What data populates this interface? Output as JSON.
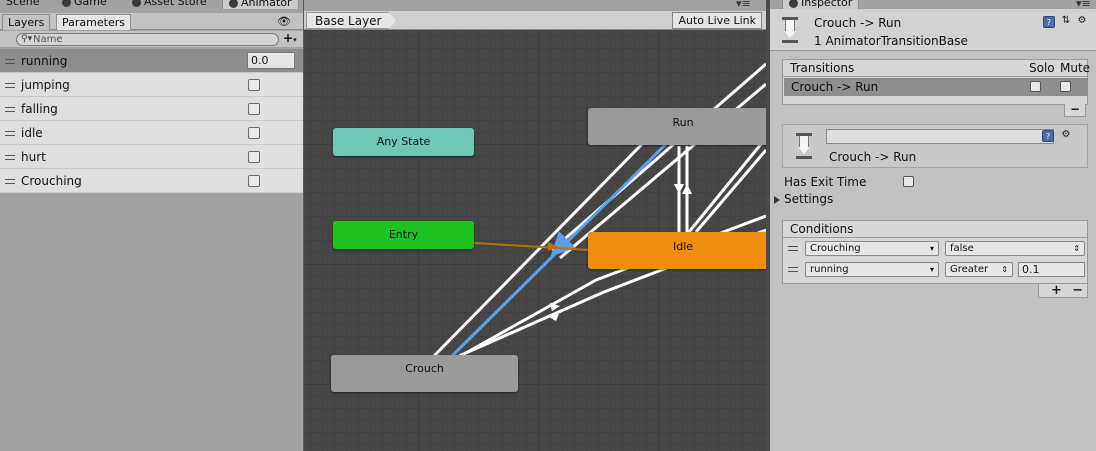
{
  "top_tabs": [
    {
      "label": "Scene"
    },
    {
      "label": "Game"
    },
    {
      "label": "Asset Store"
    },
    {
      "label": "Animator"
    }
  ],
  "left_panel": {
    "tabs": [
      "Layers",
      "Parameters"
    ],
    "search_placeholder": "Name",
    "parameters": [
      {
        "name": "running",
        "type": "float",
        "value": "0.0"
      },
      {
        "name": "jumping",
        "type": "bool",
        "value": false
      },
      {
        "name": "falling",
        "type": "bool",
        "value": false
      },
      {
        "name": "idle",
        "type": "bool",
        "value": false
      },
      {
        "name": "hurt",
        "type": "bool",
        "value": false
      },
      {
        "name": "Crouching",
        "type": "bool",
        "value": false
      }
    ]
  },
  "animator": {
    "breadcrumb": "Base Layer",
    "live_link_label": "Auto Live Link",
    "states": {
      "any_state": {
        "label": "Any State",
        "color": "#6fc7b8"
      },
      "entry": {
        "label": "Entry",
        "color": "#1ec21e"
      },
      "run": {
        "label": "Run",
        "color": "#9a9a9a"
      },
      "idle": {
        "label": "Idle",
        "color": "#f08c10"
      },
      "crouch": {
        "label": "Crouch",
        "color": "#9a9a9a"
      }
    },
    "selected_transition_color": "#5e9ee8"
  },
  "inspector": {
    "tab_label": "Inspector",
    "title": "Crouch -> Run",
    "subtitle": "1 AnimatorTransitionBase",
    "transitions": {
      "header": "Transitions",
      "solo_label": "Solo",
      "mute_label": "Mute",
      "rows": [
        {
          "label": "Crouch -> Run",
          "solo": false,
          "mute": false
        }
      ],
      "remove_label": "−"
    },
    "sub_name_value": "",
    "sub_title": "Crouch -> Run",
    "has_exit_time_label": "Has Exit Time",
    "has_exit_time": false,
    "settings_label": "Settings",
    "conditions": {
      "header": "Conditions",
      "rows": [
        {
          "parameter": "Crouching",
          "mode": "false",
          "value": ""
        },
        {
          "parameter": "running",
          "mode": "Greater",
          "value": "0.1"
        }
      ],
      "add_label": "+",
      "remove_label": "−"
    }
  }
}
